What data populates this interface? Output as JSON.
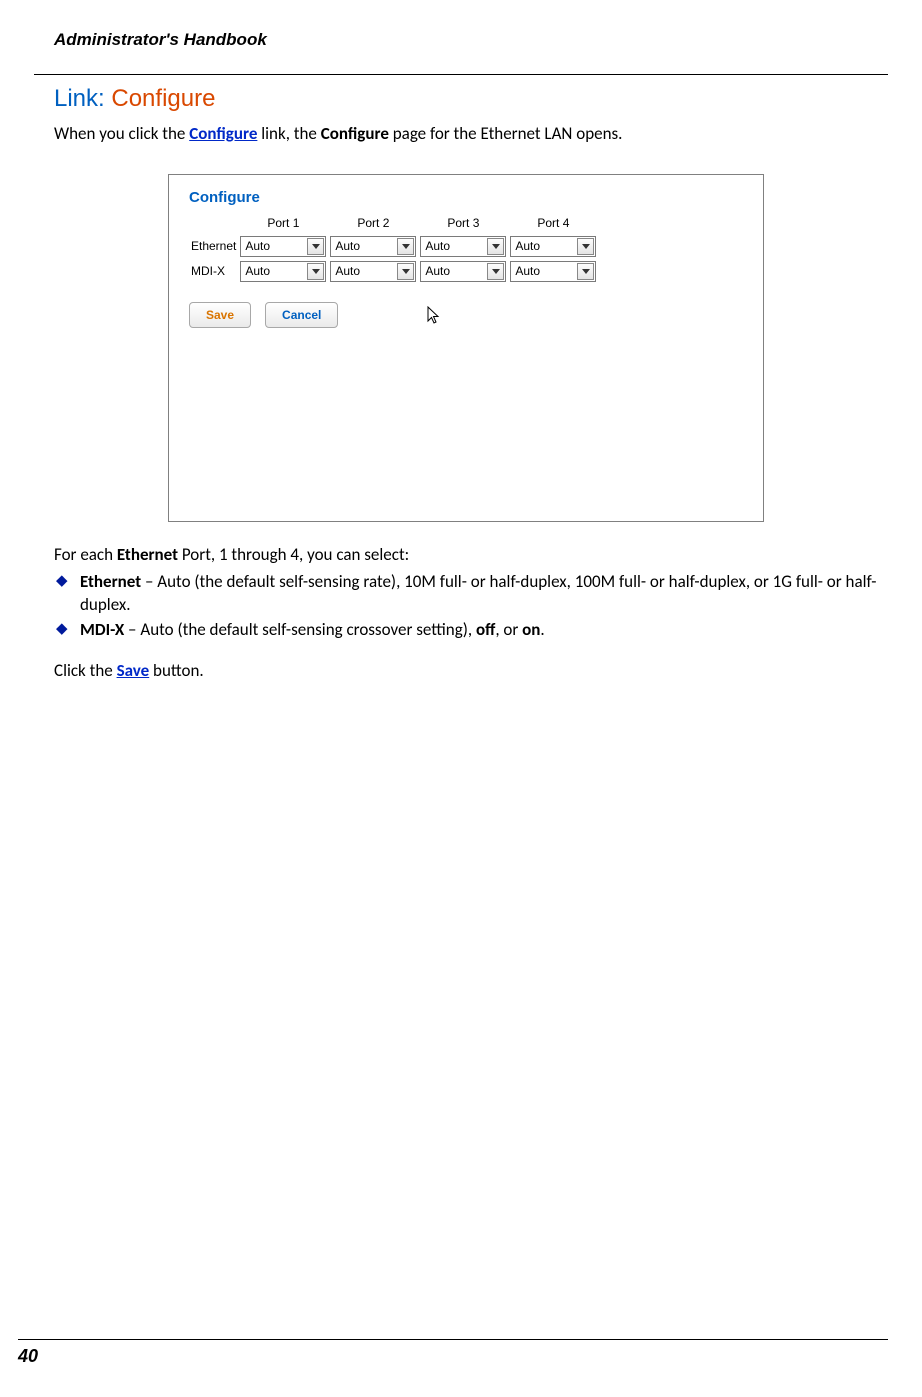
{
  "header": {
    "title": "Administrator's Handbook"
  },
  "section": {
    "prefix": "Link: ",
    "suffix": "Configure"
  },
  "intro": {
    "pre": "When you click the ",
    "link": "Configure",
    "mid": " link, the ",
    "bold": "Configure",
    "post": " page for the Ethernet LAN opens."
  },
  "screenshot": {
    "title": "Configure",
    "columns": [
      "Port 1",
      "Port 2",
      "Port 3",
      "Port 4"
    ],
    "rows": [
      {
        "label": "Ethernet",
        "values": [
          "Auto",
          "Auto",
          "Auto",
          "Auto"
        ]
      },
      {
        "label": "MDI-X",
        "values": [
          "Auto",
          "Auto",
          "Auto",
          "Auto"
        ]
      }
    ],
    "buttons": {
      "save": "Save",
      "cancel": "Cancel"
    }
  },
  "after": {
    "pre": "For each ",
    "bold": "Ethernet",
    "post": " Port, 1 through 4, you can select:"
  },
  "bullets": [
    {
      "bold": "Ethernet",
      "text": " – Auto (the default self-sensing rate), 10M full- or half-duplex, 100M full- or half-duplex, or 1G full- or half-duplex."
    },
    {
      "bold": "MDI-X",
      "text_pre": " – Auto (the default self-sensing crossover setting), ",
      "bold2": "off",
      "text_mid": ", or ",
      "bold3": "on",
      "text_post": "."
    }
  ],
  "click_save": {
    "pre": "Click the ",
    "link": "Save",
    "post": " button."
  },
  "footer": {
    "page": "40"
  }
}
